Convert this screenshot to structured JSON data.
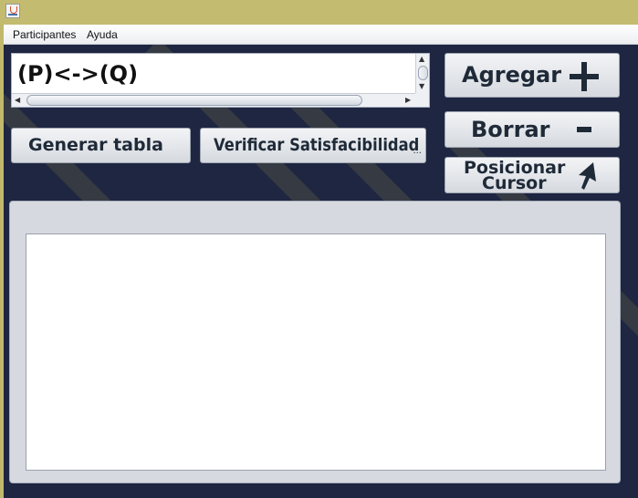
{
  "window": {
    "icon": "java-cup-icon"
  },
  "menubar": {
    "items": [
      "Participantes",
      "Ayuda"
    ]
  },
  "formula": {
    "value": "(P)<->(Q)"
  },
  "buttons": {
    "agregar": "Agregar",
    "borrar": "Borrar",
    "posicionar_line1": "Posicionar",
    "posicionar_line2": "Cursor",
    "generar_tabla": "Generar tabla",
    "verificar": "Verificar Satisfacibilidad",
    "verificar_ellipsis": "..."
  },
  "icons": {
    "agregar": "plus-icon",
    "borrar": "minus-icon",
    "posicionar": "cursor-arrow-icon"
  },
  "colors": {
    "background": "#1e2642",
    "button_text": "#1f2a38",
    "titlebar": "#c3bb6f"
  }
}
